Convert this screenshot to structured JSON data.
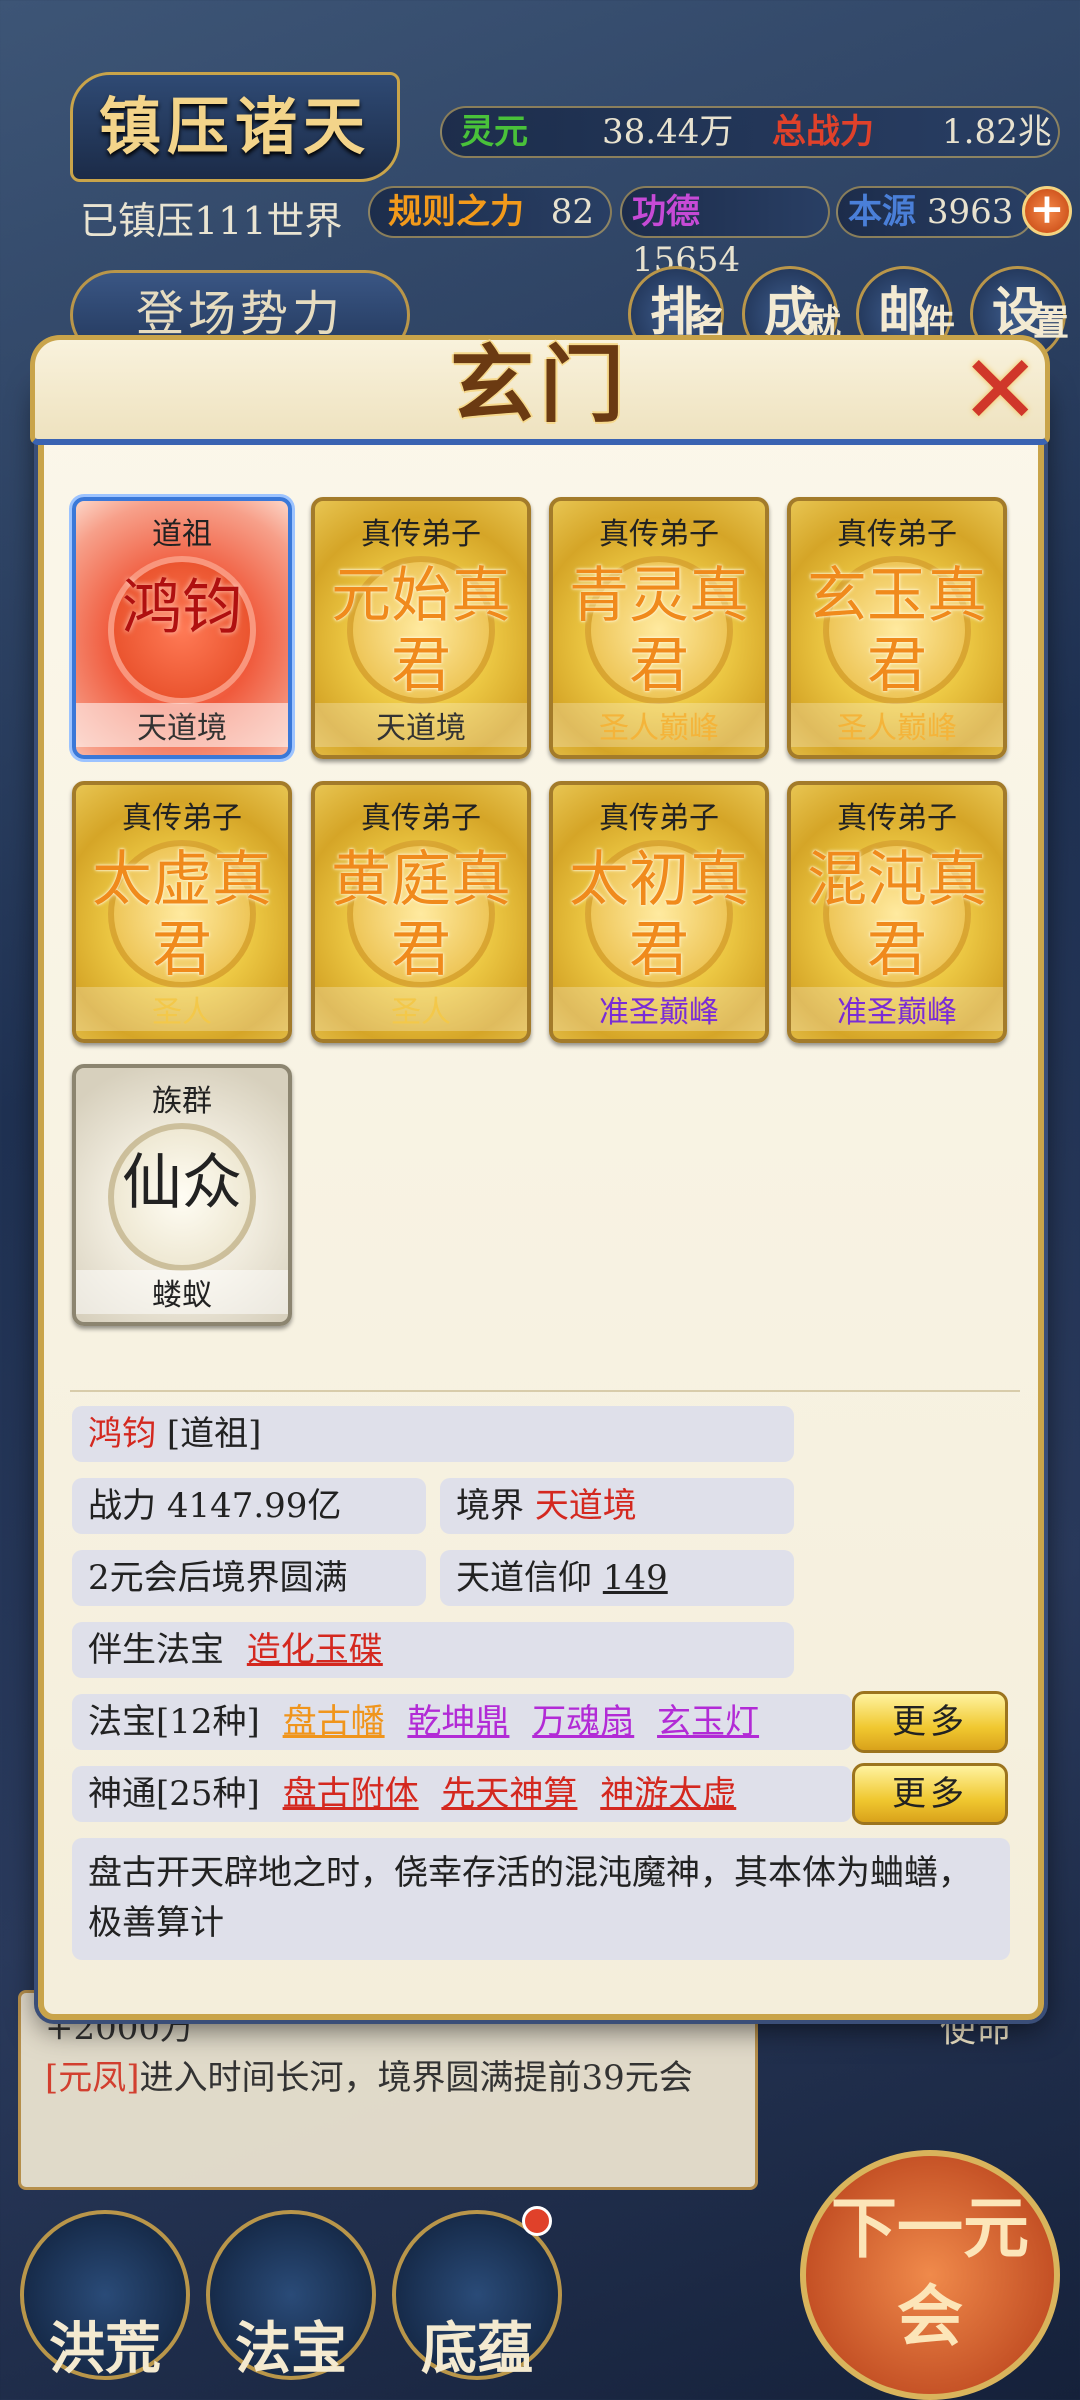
{
  "header": {
    "title": "镇压诸天",
    "subtitle": "已镇压111世界",
    "stats": [
      {
        "key": "灵元",
        "value": "38.44万",
        "color": "#49c23a"
      },
      {
        "key": "总战力",
        "value": "1.82兆",
        "color": "#e0412a"
      },
      {
        "key": "规则之力",
        "value": "82",
        "color": "#f29a1b"
      },
      {
        "key": "功德",
        "value": "15654",
        "color": "#c64ad6"
      },
      {
        "key": "本源",
        "value": "3963",
        "color": "#4a7fd8"
      }
    ],
    "plus": "+",
    "faction_button": "登场势力",
    "menu": [
      {
        "main": "排",
        "sub": "名"
      },
      {
        "main": "成",
        "sub": "就"
      },
      {
        "main": "邮",
        "sub": "件"
      },
      {
        "main": "设",
        "sub": "置"
      }
    ]
  },
  "modal": {
    "title": "玄门",
    "close": "✕",
    "cards": [
      {
        "rank": "道祖",
        "name": "鸿钧",
        "realm": "天道境",
        "style": "red"
      },
      {
        "rank": "真传弟子",
        "name": "元始真君",
        "realm": "天道境",
        "style": "gold"
      },
      {
        "rank": "真传弟子",
        "name": "青灵真君",
        "realm": "圣人巅峰",
        "style": "gold"
      },
      {
        "rank": "真传弟子",
        "name": "玄玉真君",
        "realm": "圣人巅峰",
        "style": "gold"
      },
      {
        "rank": "真传弟子",
        "name": "太虚真君",
        "realm": "圣人",
        "style": "gold"
      },
      {
        "rank": "真传弟子",
        "name": "黄庭真君",
        "realm": "圣人",
        "style": "gold"
      },
      {
        "rank": "真传弟子",
        "name": "太初真君",
        "realm": "准圣巅峰",
        "style": "gold"
      },
      {
        "rank": "真传弟子",
        "name": "混沌真君",
        "realm": "准圣巅峰",
        "style": "gold"
      },
      {
        "rank": "族群",
        "name": "仙众",
        "realm": "蝼蚁",
        "style": "grey"
      }
    ],
    "detail": {
      "name": "鸿钧",
      "rank": "[道祖]",
      "power_label": "战力",
      "power": "4147.99亿",
      "realm_label": "境界",
      "realm": "天道境",
      "countdown": "2元会后境界圆满",
      "faith_label": "天道信仰",
      "faith": "149",
      "companion_label": "伴生法宝",
      "companion": "造化玉碟",
      "treasures_label": "法宝[12种]",
      "treasures": [
        "盘古幡",
        "乾坤鼎",
        "万魂扇",
        "玄玉灯"
      ],
      "skills_label": "神通[25种]",
      "skills": [
        "盘古附体",
        "先天神算",
        "神游太虚"
      ],
      "more": "更多",
      "description": "盘古开天辟地之时，侥幸存活的混沌魔神，其本体为蛐蟮，极善算计"
    }
  },
  "background": {
    "log_line1": "+2000万",
    "log_name": "[元凤]",
    "log_text": "进入时间长河，境界圆满提前39元会",
    "side_label": "使命",
    "bottom": [
      "洪荒",
      "法宝",
      "底蕴"
    ],
    "next": "下一元会"
  }
}
